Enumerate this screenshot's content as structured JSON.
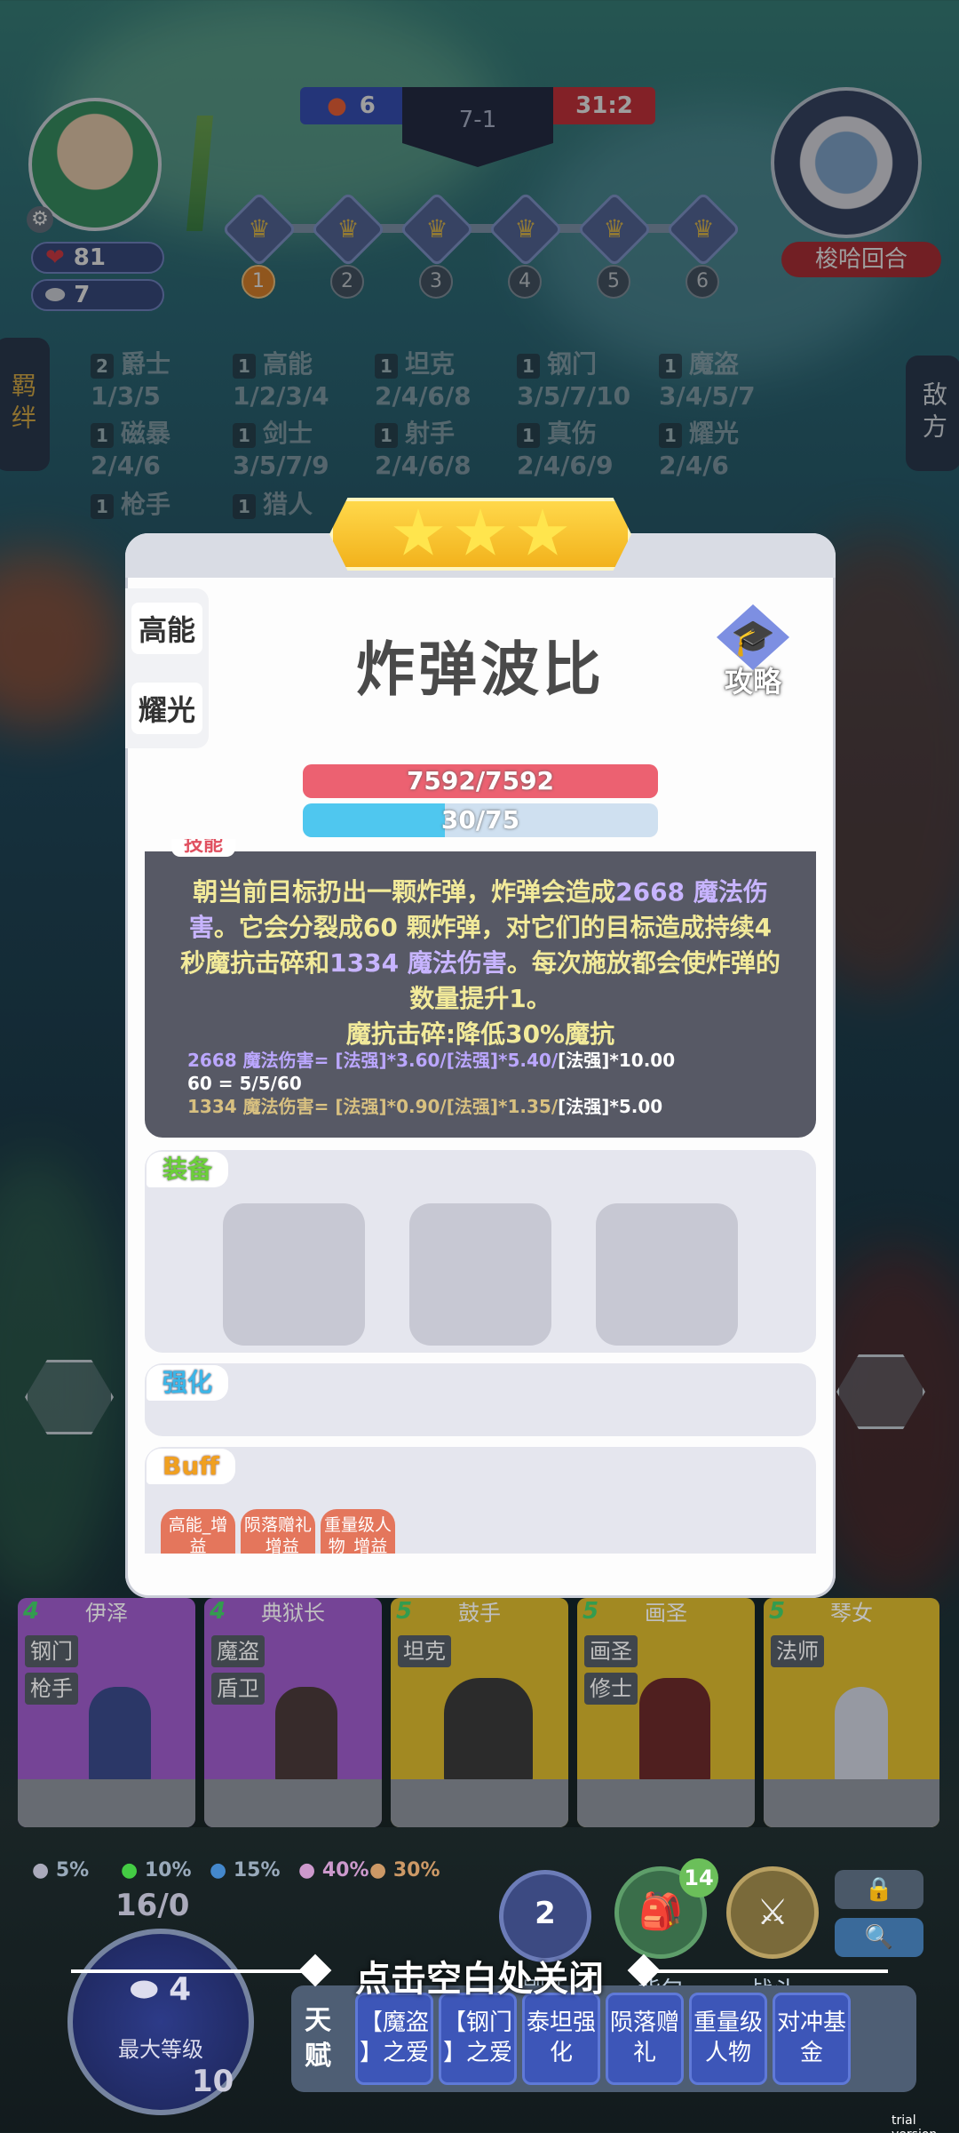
{
  "hud": {
    "health": "81",
    "coins_small": "7",
    "score_left": "6",
    "stage": "7-1",
    "score_right": "31:2",
    "rounds": [
      "1",
      "2",
      "3",
      "4",
      "5",
      "6"
    ],
    "boss_name": "梭哈回合"
  },
  "side_tabs": {
    "left": "羁绊",
    "right": "敌方"
  },
  "synergies": [
    {
      "count": "2",
      "name": "爵士",
      "tiers": "1/3/5"
    },
    {
      "count": "1",
      "name": "高能",
      "tiers": "1/2/3/4"
    },
    {
      "count": "1",
      "name": "坦克",
      "tiers": "2/4/6/8"
    },
    {
      "count": "1",
      "name": "钢门",
      "tiers": "3/5/7/10"
    },
    {
      "count": "1",
      "name": "魔盗",
      "tiers": "3/4/5/7"
    },
    {
      "count": "1",
      "name": "磁暴",
      "tiers": "2/4/6"
    },
    {
      "count": "1",
      "name": "剑士",
      "tiers": "3/5/7/9"
    },
    {
      "count": "1",
      "name": "射手",
      "tiers": "2/4/6/8"
    },
    {
      "count": "1",
      "name": "真伤",
      "tiers": "2/4/6/9"
    },
    {
      "count": "1",
      "name": "耀光",
      "tiers": "2/4/6"
    },
    {
      "count": "1",
      "name": "枪手",
      "tiers": ""
    },
    {
      "count": "1",
      "name": "猎人",
      "tiers": ""
    }
  ],
  "unit": {
    "name": "炸弹波比",
    "stars": 3,
    "traits": [
      "高能",
      "耀光"
    ],
    "guide_label": "攻略",
    "hp_text": "7592/7592",
    "hp_fraction": 1.0,
    "mana_text": "30/75",
    "mana_fraction": 0.4,
    "skill_tag": "技能",
    "skill_text_1": "朝当前目标扔出一颗炸弹，炸弹会造成",
    "skill_dmg_1": "2668 魔法伤",
    "skill_text_2a": "害",
    "skill_text_2": "。它会分裂成60 颗炸弹，对它们的目标造成持续4秒魔抗击碎和",
    "skill_dmg_2": "1334 魔法伤害",
    "skill_text_3": "。每次施放都会使炸弹的数量提升1。",
    "skill_text_4": "魔抗击碎:降低30%魔抗",
    "formula_1a": "2668 魔法伤害= [法强]*3.60/[法强]*5.40/",
    "formula_1b": "[法强]*10.00",
    "formula_2": "60 = 5/5/60",
    "formula_3a": "1334 魔法伤害= [法强]*0.90/[法强]*1.35/",
    "formula_3b": "[法强]*5.00"
  },
  "sections": {
    "equip": "装备",
    "enhance": "强化",
    "buff": "Buff"
  },
  "buffs": [
    {
      "line1": "高能_增",
      "line2": "益"
    },
    {
      "line1": "陨落赠礼",
      "line2": "_增益"
    },
    {
      "line1": "重量级人",
      "line2": "物_增益"
    }
  ],
  "bench": [
    {
      "cost": "4",
      "name": "伊泽",
      "tags": [
        "钢门",
        "枪手"
      ],
      "color": "#9c5bc9"
    },
    {
      "cost": "4",
      "name": "典狱长",
      "tags": [
        "魔盗",
        "盾卫"
      ],
      "color": "#9c5bc9"
    },
    {
      "cost": "5",
      "name": "鼓手",
      "tags": [
        "坦克"
      ],
      "color": "#d8b72e"
    },
    {
      "cost": "5",
      "name": "画圣",
      "tags": [
        "画圣",
        "修士"
      ],
      "color": "#d8b72e"
    },
    {
      "cost": "5",
      "name": "琴女",
      "tags": [
        "法师"
      ],
      "color": "#d8b72e"
    }
  ],
  "odds": [
    "5%",
    "10%",
    "15%",
    "40%",
    "30%"
  ],
  "level": {
    "xp": "16/0",
    "coins": "4",
    "label": "最大等级",
    "level_num": "10"
  },
  "buttons": {
    "refresh_cost": "2",
    "refresh": "刷新",
    "bag": "背包",
    "bag_badge": "14",
    "fight": "战斗"
  },
  "close_hint": "点击空白处关闭",
  "talents": {
    "label_1": "天",
    "label_2": "赋",
    "items": [
      {
        "l1": "【魔盗",
        "l2": "】之爱"
      },
      {
        "l1": "【钢门",
        "l2": "】之爱"
      },
      {
        "l1": "泰坦强",
        "l2": "化"
      },
      {
        "l1": "陨落赠",
        "l2": "礼"
      },
      {
        "l1": "重量级",
        "l2": "人物"
      },
      {
        "l1": "对冲基",
        "l2": "金"
      }
    ]
  },
  "watermark": "trial version"
}
